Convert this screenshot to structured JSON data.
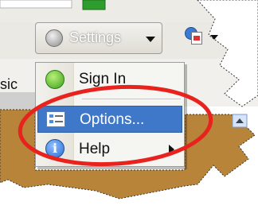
{
  "toolbar": {
    "settings_label": "Settings",
    "cut_text": "sic"
  },
  "menu": {
    "items": [
      {
        "label": "Sign In",
        "icon": "green-status-icon"
      },
      {
        "label": "Options...",
        "icon": "options-icon",
        "highlighted": true
      },
      {
        "label": "Help",
        "icon": "info-icon",
        "has_submenu": true
      }
    ]
  },
  "colors": {
    "highlight": "#3f78c8",
    "annotation_ellipse": "#e8231e",
    "torn_background": "#b8843a"
  }
}
